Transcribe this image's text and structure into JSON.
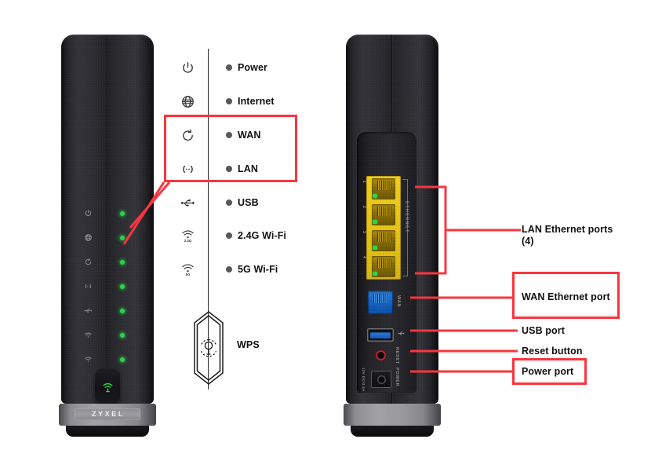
{
  "accent": {
    "red": "#f9353f",
    "led_green": "#2ad24a",
    "lan_yellow": "#e8c413",
    "wan_blue": "#1466c8",
    "usb_blue": "#1159b4",
    "reset_red": "#c0212b",
    "bullet_gray": "#58585a",
    "text_black": "#111111"
  },
  "front_view": {
    "brand": "ZYXEL",
    "led_count": 7,
    "leds": [
      {
        "name": "power",
        "color": "#2ad24a",
        "lit": true
      },
      {
        "name": "internet",
        "color": "#2ad24a",
        "lit": true
      },
      {
        "name": "wan",
        "color": "#2ad24a",
        "lit": true
      },
      {
        "name": "lan",
        "color": "#2ad24a",
        "lit": true
      },
      {
        "name": "usb",
        "color": "#2ad24a",
        "lit": true
      },
      {
        "name": "wifi-2-4g",
        "color": "#2ad24a",
        "lit": true
      },
      {
        "name": "wifi-5g",
        "color": "#2ad24a",
        "lit": true
      }
    ],
    "wps_button": "WPS"
  },
  "legend": {
    "items": [
      {
        "icon": "power-icon",
        "label": "Power"
      },
      {
        "icon": "globe-icon",
        "label": "Internet"
      },
      {
        "icon": "wan-loop-icon",
        "label": "WAN"
      },
      {
        "icon": "lan-signal-icon",
        "label": "LAN"
      },
      {
        "icon": "usb-icon",
        "label": "USB"
      },
      {
        "icon": "wifi-icon",
        "sub": "2.4G",
        "label": "2.4G Wi-Fi"
      },
      {
        "icon": "wifi-icon",
        "sub": "5G",
        "label": "5G Wi-Fi"
      }
    ],
    "wps": {
      "icon": "wps-icon",
      "label": "WPS"
    }
  },
  "rear_view": {
    "lan_ports": {
      "count": 4,
      "group_label": "ETHERNET",
      "numbers": [
        "1",
        "2",
        "3",
        "4"
      ]
    },
    "wan_port": {
      "label": "WAN"
    },
    "usb_port": {
      "icon": "usb-icon"
    },
    "reset_button": {
      "label": "RESET"
    },
    "power_port": {
      "label": "POWER",
      "rating": "12V DC/3.6A"
    }
  },
  "callouts": [
    {
      "name": "lan-ethernet-ports",
      "label": "LAN Ethernet ports\n(4)",
      "boxed": false
    },
    {
      "name": "wan-ethernet-port",
      "label": "WAN Ethernet port",
      "boxed": true
    },
    {
      "name": "usb-port",
      "label": "USB port",
      "boxed": false
    },
    {
      "name": "reset-button",
      "label": "Reset button",
      "boxed": false
    },
    {
      "name": "power-port",
      "label": "Power port",
      "boxed": true
    }
  ]
}
